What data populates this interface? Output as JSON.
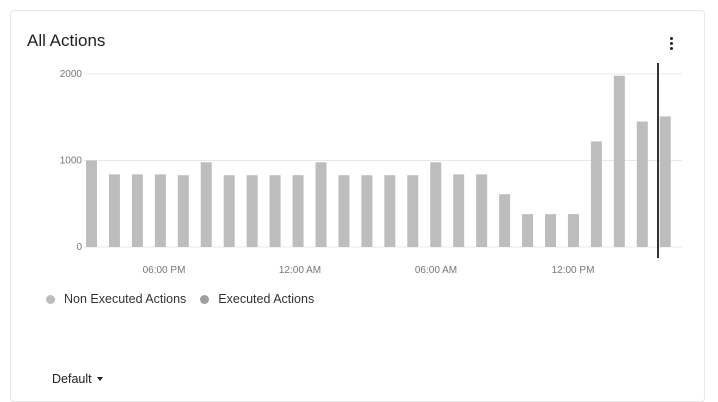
{
  "card": {
    "title": "All Actions",
    "menu_icon": "more-vertical-icon"
  },
  "colors": {
    "non_executed": "#bdbdbd",
    "executed": "#9e9e9e",
    "grid": "#e8e8e8",
    "cursor_line": "#333333"
  },
  "legend": {
    "items": [
      {
        "label": "Non Executed Actions",
        "color": "#bdbdbd"
      },
      {
        "label": "Executed Actions",
        "color": "#9e9e9e"
      }
    ]
  },
  "dropdown": {
    "label": "Default",
    "icon": "caret-down-icon"
  },
  "chart_data": {
    "type": "bar",
    "title": "All Actions",
    "yticks": [
      "0",
      "1000",
      "2000"
    ],
    "xticks": [
      "06:00 PM",
      "12:00 AM",
      "06:00 AM",
      "12:00 PM"
    ],
    "ylim": [
      0,
      2000
    ],
    "grid": true,
    "legend_position": "bottom-left",
    "series": [
      {
        "name": "Non Executed Actions",
        "values": [
          1000,
          840,
          840,
          840,
          830,
          980,
          830,
          830,
          830,
          830,
          980,
          830,
          830,
          830,
          830,
          980,
          840,
          840,
          610,
          380,
          380,
          380,
          1220,
          1980,
          1450,
          1510
        ]
      },
      {
        "name": "Executed Actions",
        "values": [
          0,
          0,
          0,
          0,
          0,
          0,
          0,
          0,
          0,
          0,
          0,
          0,
          0,
          0,
          0,
          0,
          0,
          0,
          0,
          0,
          0,
          0,
          0,
          0,
          0,
          0
        ]
      }
    ]
  }
}
